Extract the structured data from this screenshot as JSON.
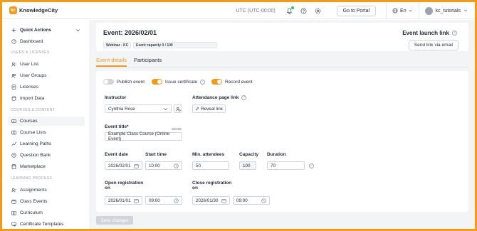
{
  "app": {
    "logo_text": "KnowledgeCity",
    "logo_mark": "kc"
  },
  "topbar": {
    "timezone": "UTC (UTC-00:00)",
    "portal_button": "Go to Portal",
    "language": "En",
    "username": "kc_tutorials"
  },
  "sidebar": {
    "quick_actions": "Quick Actions",
    "dashboard": "Dashboard",
    "section_users": "USERS & LICENSES",
    "user_list": "User List",
    "user_groups": "User Groups",
    "licenses": "Licenses",
    "import_data": "Import Data",
    "section_courses": "COURSES & CONTENT",
    "courses": "Courses",
    "course_lists": "Course Lists",
    "learning_paths": "Learning Paths",
    "question_bank": "Question Bank",
    "marketplace": "Marketplace",
    "section_process": "LEARNING PROCESS",
    "assignments": "Assignments",
    "class_events": "Class Events",
    "curriculum": "Curriculum",
    "certificate_templates": "Certificate Templates"
  },
  "event": {
    "title": "Event: 2026/02/01",
    "chip_webinar": "Webinar - KC",
    "chip_capacity": "Event capacity 0 / 100",
    "launch_link_label": "Event launch link",
    "send_link_button": "Send link via email"
  },
  "tabs": {
    "details": "Event details",
    "participants": "Participants"
  },
  "form": {
    "publish_event": "Publish event",
    "issue_certificate": "Issue certificate",
    "record_event": "Record event",
    "instructor_label": "Instructor",
    "instructor_value": "Cynthia Rose",
    "attendance_label": "Attendance page link",
    "reveal_link": "Reveal link",
    "event_title_label": "Event title*",
    "event_title_count": "30/255",
    "event_title_value": "Example Class Course (Online Event)",
    "event_date_label": "Event date",
    "event_date_value": "2026/02/01",
    "start_time_label": "Start time",
    "start_time_value": "10:00",
    "min_attendees_label": "Min. attendees",
    "min_attendees_value": "50",
    "capacity_label": "Capacity",
    "capacity_value": "100",
    "duration_label": "Duration",
    "duration_value": "70",
    "open_reg_label_1": "Open registration",
    "open_reg_label_2": "on",
    "open_reg_date": "2026/01/01",
    "open_reg_time": "09:00",
    "close_reg_label_1": "Close registration",
    "close_reg_label_2": "on",
    "close_reg_date": "2026/01/30",
    "close_reg_time": "09:00",
    "save_button": "Save changes"
  },
  "toggles": {
    "publish_event": false,
    "issue_certificate": true,
    "record_event": true
  },
  "colors": {
    "accent": "#f39a1d",
    "notification_dot": "#22c55e"
  }
}
